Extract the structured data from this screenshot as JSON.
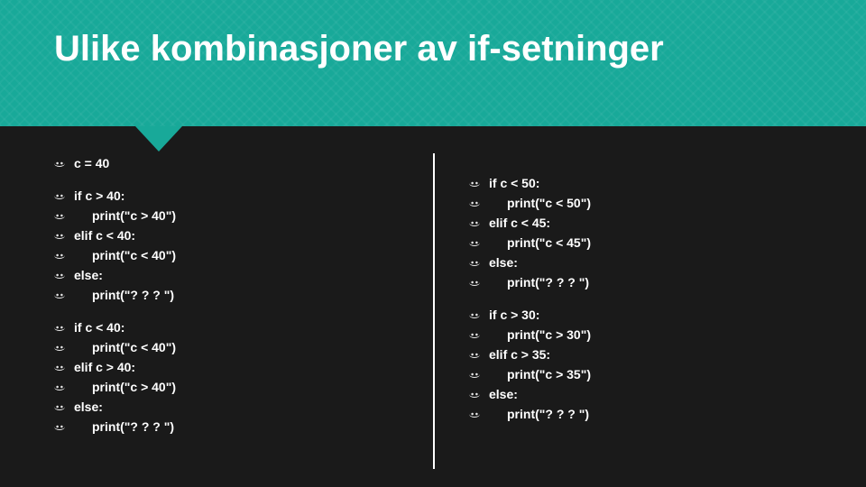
{
  "title": "Ulike kombinasjoner av if-setninger",
  "left": {
    "block1": [
      "c = 40"
    ],
    "block2": [
      {
        "t": "if c > 40:",
        "i": 0
      },
      {
        "t": "print(\"c > 40\")",
        "i": 1
      },
      {
        "t": "elif c < 40:",
        "i": 0
      },
      {
        "t": "print(\"c < 40\")",
        "i": 1
      },
      {
        "t": "else:",
        "i": 0
      },
      {
        "t": "print(\"? ? ? \")",
        "i": 1
      }
    ],
    "block3": [
      {
        "t": "if c < 40:",
        "i": 0
      },
      {
        "t": "print(\"c < 40\")",
        "i": 1
      },
      {
        "t": "elif c > 40:",
        "i": 0
      },
      {
        "t": "print(\"c > 40\")",
        "i": 1
      },
      {
        "t": "else:",
        "i": 0
      },
      {
        "t": "print(\"? ? ? \")",
        "i": 1
      }
    ]
  },
  "right": {
    "block1": [
      {
        "t": "if c < 50:",
        "i": 0
      },
      {
        "t": "print(\"c < 50\")",
        "i": 1
      },
      {
        "t": "elif c < 45:",
        "i": 0
      },
      {
        "t": "print(\"c < 45\")",
        "i": 1
      },
      {
        "t": "else:",
        "i": 0
      },
      {
        "t": "print(\"? ? ? \")",
        "i": 1
      }
    ],
    "block2": [
      {
        "t": "if c > 30:",
        "i": 0
      },
      {
        "t": "print(\"c > 30\")",
        "i": 1
      },
      {
        "t": "elif c > 35:",
        "i": 0
      },
      {
        "t": "print(\"c > 35\")",
        "i": 1
      },
      {
        "t": "else:",
        "i": 0
      },
      {
        "t": "print(\"? ? ? \")",
        "i": 1
      }
    ]
  }
}
